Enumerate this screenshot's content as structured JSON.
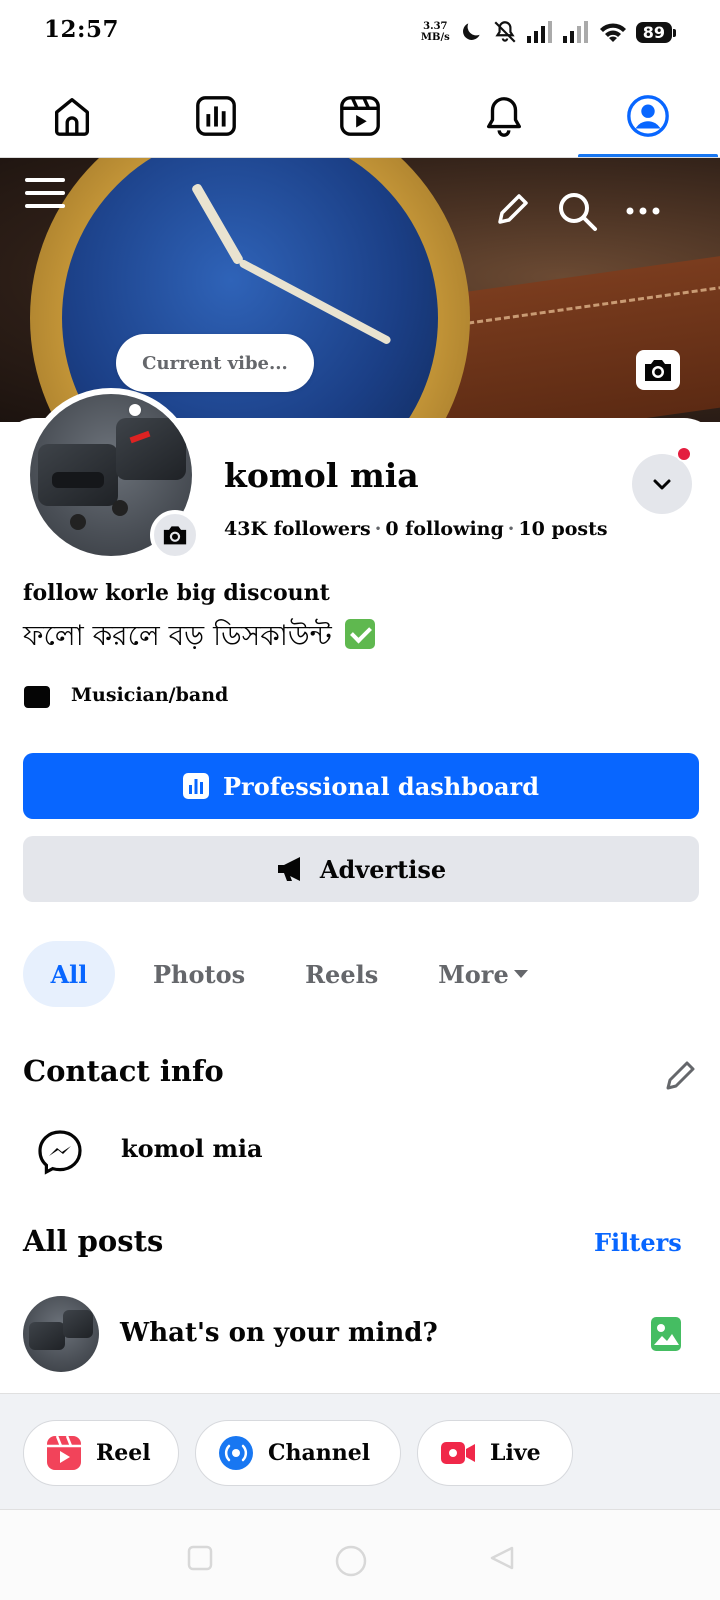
{
  "status_bar": {
    "time": "12:57",
    "net_speed_value": "3.37",
    "net_speed_unit": "MB/s",
    "battery": "89"
  },
  "top_nav": {
    "tabs": [
      {
        "icon": "home-icon",
        "active": false
      },
      {
        "icon": "dashboard-icon",
        "active": false
      },
      {
        "icon": "reels-icon",
        "active": false
      },
      {
        "icon": "bell-icon",
        "active": false
      },
      {
        "icon": "profile-icon",
        "active": true
      }
    ]
  },
  "cover": {
    "vibe_prompt": "Current vibe..."
  },
  "profile": {
    "name": "komol mia",
    "followers": "43K followers",
    "following": "0 following",
    "posts": "10 posts",
    "separator": "·",
    "bio_en": "follow korle big discount",
    "bio_bn": "ফলো করলে বড় ডিসকাউন্ট",
    "category": "Musician/band"
  },
  "actions": {
    "primary_label": "Professional dashboard",
    "secondary_label": "Advertise"
  },
  "filter_tabs": {
    "all": "All",
    "photos": "Photos",
    "reels": "Reels",
    "more": "More"
  },
  "contact": {
    "title": "Contact info",
    "messenger_name": "komol mia"
  },
  "posts": {
    "title": "All posts",
    "filters_label": "Filters",
    "composer_placeholder": "What's on your mind?"
  },
  "quick_actions": {
    "reel": "Reel",
    "channel": "Channel",
    "live": "Live"
  },
  "colors": {
    "accent": "#0866ff",
    "secondary_button": "#e4e6eb",
    "notification_dot": "#e41e3f",
    "photo_icon": "#45bd62"
  }
}
